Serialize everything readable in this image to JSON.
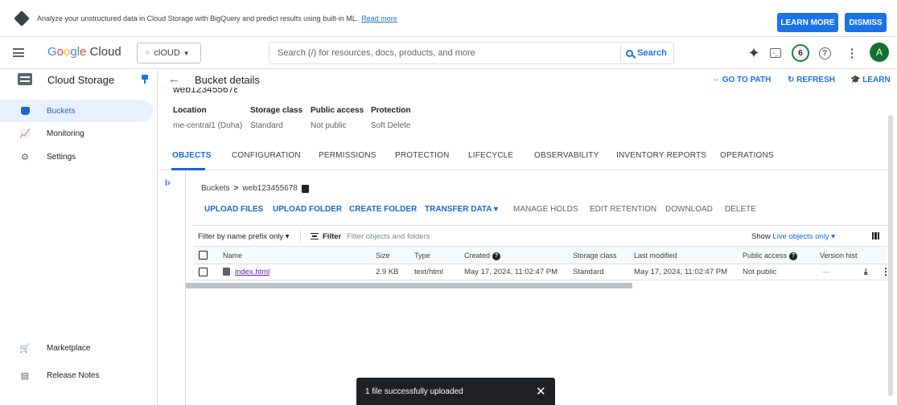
{
  "banner": {
    "text": "Analyze your unstructured data in Cloud Storage with BigQuery and predict results using built-in ML.",
    "link": "Read more",
    "learn_more": "LEARN MORE",
    "dismiss": "DISMISS"
  },
  "topnav": {
    "logo_g": "G",
    "logo_o1": "o",
    "logo_o2": "o",
    "logo_g2": "g",
    "logo_l": "l",
    "logo_e": "e",
    "logo_cloud": " Cloud",
    "project": "clOUD",
    "search_placeholder": "Search (/) for resources, docs, products, and more",
    "search_button": "Search",
    "notifications_count": "6",
    "avatar_initial": "A"
  },
  "sidebar": {
    "title": "Cloud Storage",
    "items": [
      {
        "label": "Buckets",
        "icon": "bucket-icon",
        "active": true
      },
      {
        "label": "Monitoring",
        "icon": "monitoring-icon"
      },
      {
        "label": "Settings",
        "icon": "gear-icon"
      }
    ],
    "bottom_items": [
      {
        "label": "Marketplace",
        "icon": "cart-icon"
      },
      {
        "label": "Release Notes",
        "icon": "notes-icon"
      }
    ]
  },
  "header": {
    "title": "Bucket details",
    "go_to_path": "GO TO PATH",
    "refresh": "REFRESH",
    "learn": "LEARN"
  },
  "bucket": {
    "location_label": "Location",
    "location_value": "me-central1 (Doha)",
    "storage_class_label": "Storage class",
    "storage_class_value": "Standard",
    "public_access_label": "Public access",
    "public_access_value": "Not public",
    "protection_label": "Protection",
    "protection_value": "Soft Delete"
  },
  "tabs": [
    "OBJECTS",
    "CONFIGURATION",
    "PERMISSIONS",
    "PROTECTION",
    "LIFECYCLE",
    "OBSERVABILITY",
    "INVENTORY REPORTS",
    "OPERATIONS"
  ],
  "breadcrumb": {
    "root": "Buckets",
    "sep": ">",
    "bucket": "web123455678"
  },
  "actions": [
    "UPLOAD FILES",
    "UPLOAD FOLDER",
    "CREATE FOLDER",
    "TRANSFER DATA ▾",
    "MANAGE HOLDS",
    "EDIT RETENTION",
    "DOWNLOAD",
    "DELETE"
  ],
  "filter": {
    "prefix": "Filter by name prefix only ▾",
    "label": "Filter",
    "placeholder": "Filter objects and folders",
    "show_label": "Show",
    "show_value": "Live objects only ▾"
  },
  "table": {
    "columns": [
      "Name",
      "Size",
      "Type",
      "Created",
      "Storage class",
      "Last modified",
      "Public access",
      "Version hist"
    ],
    "rows": [
      {
        "name": "index.html",
        "size": "2.9 KB",
        "type": "text/html",
        "created": "May 17, 2024, 11:02:47 PM",
        "storage_class": "Standard",
        "last_modified": "May 17, 2024, 11:02:47 PM",
        "public_access": "Not public",
        "version": "—"
      }
    ]
  },
  "toast": {
    "message": "1 file successfully uploaded",
    "close": "✕"
  }
}
